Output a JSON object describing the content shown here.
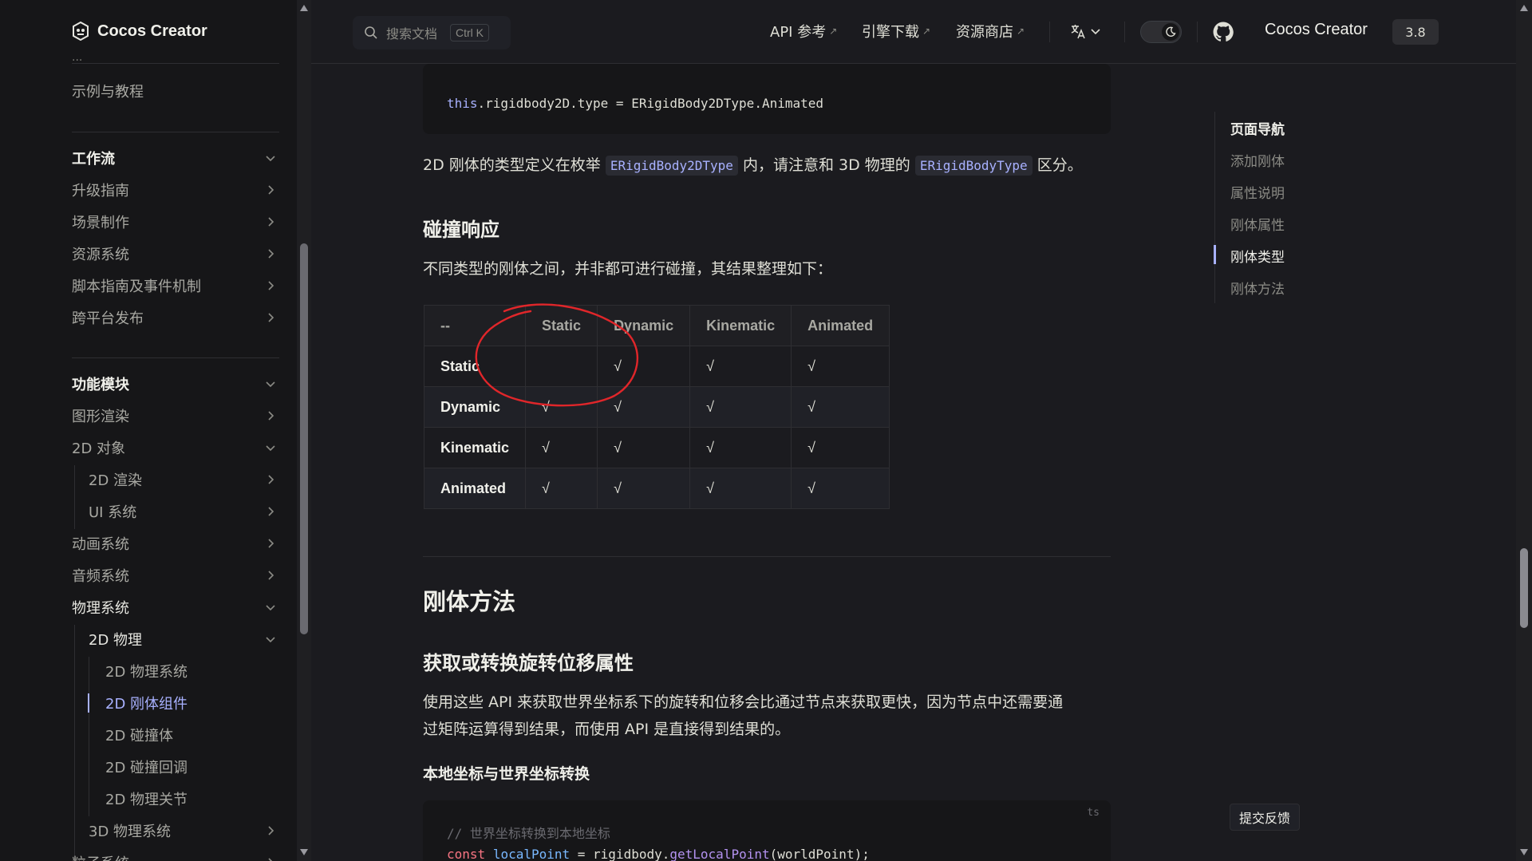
{
  "sidebar": {
    "logo_text": "Cocos Creator",
    "partial_item": "...",
    "items": [
      {
        "label": "示例与教程"
      },
      {
        "label": "工作流"
      },
      {
        "label": "升级指南"
      },
      {
        "label": "场景制作"
      },
      {
        "label": "资源系统"
      },
      {
        "label": "脚本指南及事件机制"
      },
      {
        "label": "跨平台发布"
      },
      {
        "label": "功能模块"
      },
      {
        "label": "图形渲染"
      },
      {
        "label": "2D 对象"
      },
      {
        "label": "2D 渲染"
      },
      {
        "label": "UI 系统"
      },
      {
        "label": "动画系统"
      },
      {
        "label": "音频系统"
      },
      {
        "label": "物理系统"
      },
      {
        "label": "2D 物理"
      },
      {
        "label": "2D 物理系统"
      },
      {
        "label": "2D 刚体组件"
      },
      {
        "label": "2D 碰撞体"
      },
      {
        "label": "2D 碰撞回调"
      },
      {
        "label": "2D 物理关节"
      },
      {
        "label": "3D 物理系统"
      },
      {
        "label": "粒子系统"
      }
    ]
  },
  "topbar": {
    "search_placeholder": "搜索文档",
    "search_kbd": "Ctrl K",
    "nav": [
      "API 参考",
      "引擎下载",
      "资源商店"
    ],
    "ext_arrow": "↗",
    "brand": "Cocos Creator",
    "version": "3.8"
  },
  "content": {
    "code1": {
      "kw": "this",
      "rest": ".rigidbody2D.type = ERigidBody2DType.Animated"
    },
    "p1_a": "2D 刚体的类型定义在枚举 ",
    "p1_code1": "ERigidBody2DType",
    "p1_b": " 内，请注意和 3D 物理的 ",
    "p1_code2": "ERigidBodyType",
    "p1_c": " 区分。",
    "h3_collision": "碰撞响应",
    "p2": "不同类型的刚体之间，并非都可进行碰撞，其结果整理如下：",
    "table": {
      "headers": [
        "--",
        "Static",
        "Dynamic",
        "Kinematic",
        "Animated"
      ],
      "rows": [
        [
          "Static",
          "",
          "√",
          "√",
          "√"
        ],
        [
          "Dynamic",
          "√",
          "√",
          "√",
          "√"
        ],
        [
          "Kinematic",
          "√",
          "√",
          "√",
          "√"
        ],
        [
          "Animated",
          "√",
          "√",
          "√",
          "√"
        ]
      ]
    },
    "h2_methods": "刚体方法",
    "h3_transform": "获取或转换旋转位移属性",
    "p3_line1": "使用这些 API 来获取世界坐标系下的旋转和位移会比通过节点来获取更快，因为节点中还需要通",
    "p3_line2": "过矩阵运算得到结果，而使用 API 是直接得到结果的。",
    "h4_local": "本地坐标与世界坐标转换",
    "code2": {
      "lang": "ts",
      "comment": "// 世界坐标转换到本地坐标",
      "kw": "const",
      "var": "localPoint",
      "eq": " = rigidbody.",
      "fn": "getLocalPoint",
      "args": "(worldPoint);"
    }
  },
  "toc": {
    "title": "页面导航",
    "items": [
      "添加刚体",
      "属性说明",
      "刚体属性",
      "刚体类型",
      "刚体方法"
    ]
  },
  "feedback": "提交反馈",
  "colors": {
    "accent": "#a8b1ff",
    "annotation": "#e0262a",
    "bg": "#1b1b1f"
  }
}
